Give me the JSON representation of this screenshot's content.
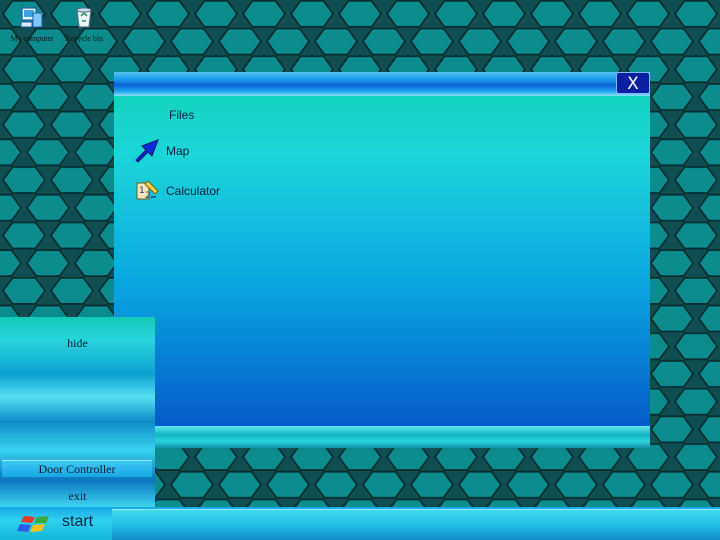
{
  "desktop": {
    "icons": [
      {
        "label": "My computer",
        "icon": "computer-icon"
      },
      {
        "label": "Recycle bin",
        "icon": "recycle-bin-icon"
      }
    ]
  },
  "window": {
    "close_label": "X",
    "items": [
      {
        "label": "Files",
        "icon": ""
      },
      {
        "label": "Map",
        "icon": "arrow-icon"
      },
      {
        "label": "Calculator",
        "icon": "calculator-icon"
      }
    ]
  },
  "start_menu": {
    "items": [
      {
        "label": "hide"
      },
      {
        "label": "Door Controller"
      },
      {
        "label": "exit"
      }
    ]
  },
  "taskbar": {
    "start_label": "start",
    "start_icon": "windows-logo-icon"
  },
  "colors": {
    "background": "#0f4f51",
    "hexagon": "#0c8c8e",
    "window_top": "#10d3b8",
    "window_bottom": "#0450c6",
    "close_button": "#0b1fa3"
  }
}
